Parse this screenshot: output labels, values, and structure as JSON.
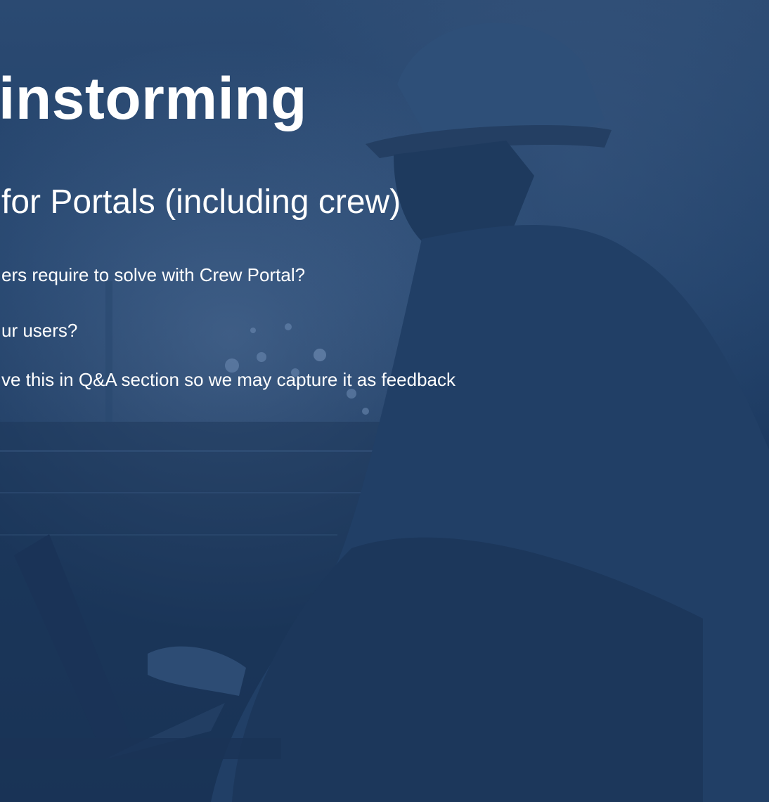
{
  "slide": {
    "title": "instorming",
    "subtitle": " for Portals (including crew)",
    "bullets": [
      "ers require to solve with Crew Portal?",
      "ur users?",
      "ve this in Q&A section so we may capture it as feedback"
    ]
  },
  "colors": {
    "overlay": "#1f3d63",
    "text": "#ffffff"
  }
}
